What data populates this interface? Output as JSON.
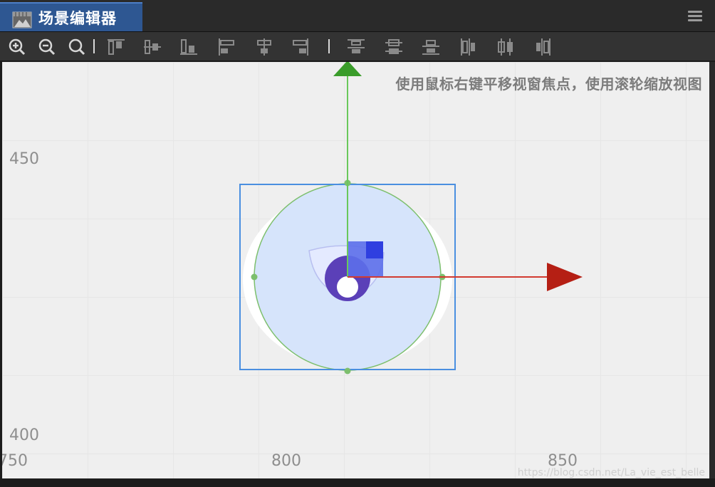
{
  "tab": {
    "title": "场景编辑器",
    "icon": "scene-icon"
  },
  "menu": {
    "icon": "hamburger-menu-icon"
  },
  "toolbar": {
    "zoom": [
      {
        "name": "zoom-in-icon"
      },
      {
        "name": "zoom-out-icon"
      },
      {
        "name": "zoom-reset-icon"
      }
    ],
    "separator": "|",
    "align": [
      {
        "name": "align-top-icon"
      },
      {
        "name": "align-v-center-icon"
      },
      {
        "name": "align-bottom-icon"
      },
      {
        "name": "align-left-icon"
      },
      {
        "name": "align-h-center-icon"
      },
      {
        "name": "align-right-icon"
      }
    ],
    "distribute": [
      {
        "name": "distribute-top-icon"
      },
      {
        "name": "distribute-v-center-icon"
      },
      {
        "name": "distribute-bottom-icon"
      },
      {
        "name": "distribute-left-icon"
      },
      {
        "name": "distribute-h-center-icon"
      },
      {
        "name": "distribute-right-icon"
      }
    ]
  },
  "scene": {
    "hint": "使用鼠标右键平移视窗焦点，使用滚轮缩放视图",
    "y_labels": [
      "450",
      "400"
    ],
    "x_labels": [
      "750",
      "800",
      "850"
    ],
    "watermark": "https://blog.csdn.net/La_vie_est_belle",
    "colors": {
      "selection": "#4a8fe0",
      "circle_stroke": "#7dbf6d",
      "circle_fill": "#d6e4fb",
      "y_axis": "#4caf3a",
      "x_axis": "#c0261e",
      "rect_handle": "#2f3fe0"
    }
  }
}
